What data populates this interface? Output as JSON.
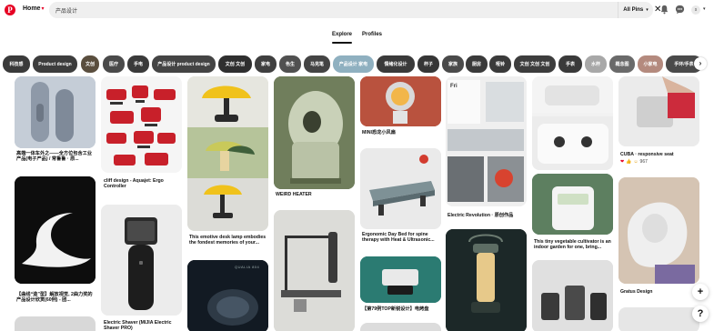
{
  "header": {
    "home_label": "Home",
    "search_value": "产品设计",
    "filter_label": "All Pins",
    "avatar_letter": "s"
  },
  "tabs": [
    {
      "label": "Explore",
      "active": true
    },
    {
      "label": "Profiles",
      "active": false
    }
  ],
  "chips": [
    {
      "label": "科技感",
      "color": "#3a3a3a"
    },
    {
      "label": "Product design",
      "color": "#3d3d3d"
    },
    {
      "label": "文创",
      "color": "#5a4e3e"
    },
    {
      "label": "医疗",
      "color": "#4a4a4a"
    },
    {
      "label": "手电",
      "color": "#3a3a3a"
    },
    {
      "label": "产品设计 product design",
      "color": "#444444"
    },
    {
      "label": "文创 文创",
      "color": "#2f2f2f"
    },
    {
      "label": "家电",
      "color": "#3f3f3f"
    },
    {
      "label": "色生",
      "color": "#505050"
    },
    {
      "label": "马克笔",
      "color": "#444444"
    },
    {
      "label": "产品设计 家电",
      "color": "#8fb0c0"
    },
    {
      "label": "情绪化设计",
      "color": "#3a3a3a"
    },
    {
      "label": "杯子",
      "color": "#363636"
    },
    {
      "label": "家族",
      "color": "#4a4a4a"
    },
    {
      "label": "厨房",
      "color": "#3a3a3a"
    },
    {
      "label": "哑铃",
      "color": "#3a3a3a"
    },
    {
      "label": "文创 文创 文创",
      "color": "#3d3d3d"
    },
    {
      "label": "手表",
      "color": "#3a3a3a"
    },
    {
      "label": "水杯",
      "color": "#a8a8a8"
    },
    {
      "label": "概念图",
      "color": "#6a6a6a"
    },
    {
      "label": "小家电",
      "color": "#b48a7e"
    },
    {
      "label": "手环/手表",
      "color": "#4a4a4a"
    }
  ],
  "pins": {
    "col1": [
      {
        "caption": "高端一体车外之——全方位包含工业产品(电子产品) / 常鲁鲁 · 原..."
      },
      {
        "caption": "【曲线“造”型】解放视觉, 2曲力奖的产品设计欣赏(60例) - 团..."
      }
    ],
    "col2": [
      {
        "caption": "cliff design - Aquajet: Ergo Controller"
      },
      {
        "caption": "Electric Shaver (MIJIA Electric Shaver PRO)"
      }
    ],
    "col3": [
      {
        "caption": "This emotive desk lamp embodies the fondest memories of your..."
      },
      {
        "brand": "QUALIA 804"
      }
    ],
    "col4": [
      {
        "caption": "WEIRD HEATER"
      }
    ],
    "col5": [
      {
        "caption": "MINI恐龙小风扇"
      },
      {
        "caption": "Ergonomic Day Bed for spine therapy with Heat & Ultrasonic..."
      },
      {
        "caption": "【第79例TOP新锐设计】电烤盘"
      }
    ],
    "col6": [
      {
        "screen_text": "Fri"
      },
      {
        "caption": "Electric Revolution · 原创作品"
      }
    ],
    "col7": [
      {
        "caption": "This tiny vegetable cultivator is an indoor garden for one, bring..."
      }
    ],
    "col8": [
      {
        "caption": "CUBA · responsive seat",
        "reactions": "967"
      },
      {
        "caption": "Gratus Design"
      }
    ]
  },
  "fab": {
    "add": "+",
    "help": "?"
  }
}
